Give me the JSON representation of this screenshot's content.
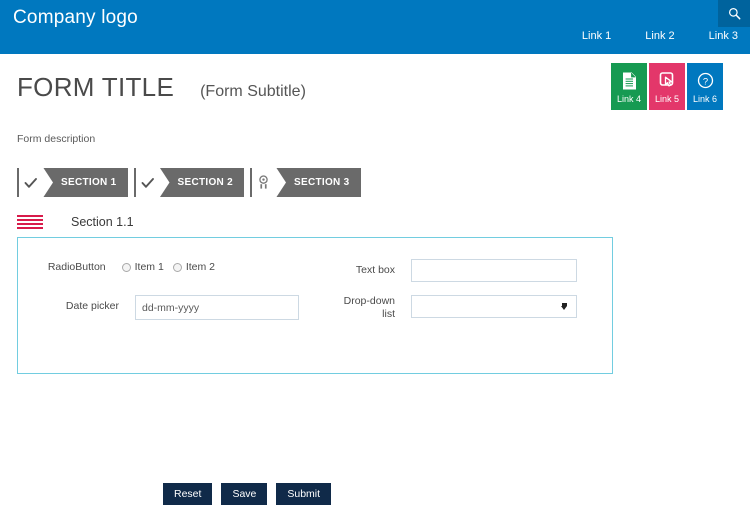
{
  "header": {
    "logo": "Company logo",
    "search_icon": "search-icon",
    "links": [
      {
        "label": "Link 1"
      },
      {
        "label": "Link 2"
      },
      {
        "label": "Link 3"
      }
    ],
    "bg_color": "#0078bf",
    "search_bg_color": "#00639d"
  },
  "title_block": {
    "title": "FORM TITLE",
    "subtitle": "(Form Subtitle)",
    "description": "Form description"
  },
  "tiles": [
    {
      "label": "Link 4",
      "icon": "document-icon",
      "color": "#169a52"
    },
    {
      "label": "Link 5",
      "icon": "click-cursor-icon",
      "color": "#e3376a"
    },
    {
      "label": "Link 6",
      "icon": "help-circle-icon",
      "color": "#0078bf"
    }
  ],
  "sections": [
    {
      "label": "SECTION 1",
      "icon": "check-icon",
      "bg_color": "#6a6a6a"
    },
    {
      "label": "SECTION 2",
      "icon": "check-icon",
      "bg_color": "#6a6a6a"
    },
    {
      "label": "SECTION 3",
      "icon": "award-icon",
      "bg_color": "#6a6a6a"
    }
  ],
  "subsection": {
    "menu_icon": "hamburger-icon",
    "menu_icon_color": "#d81b4a",
    "title": "Section 1.1",
    "panel_border_color": "#72cde0"
  },
  "form": {
    "radio": {
      "label": "RadioButton",
      "options": [
        {
          "label": "Item 1",
          "selected": false
        },
        {
          "label": "Item 2",
          "selected": false
        }
      ]
    },
    "date_picker": {
      "label": "Date picker",
      "value": "",
      "placeholder": "dd-mm-yyyy"
    },
    "text_box": {
      "label": "Text box",
      "value": "",
      "placeholder": ""
    },
    "dropdown": {
      "label_line1": "Drop-down",
      "label_line2": "list",
      "selected": "",
      "options": []
    }
  },
  "footer": {
    "buttons": [
      {
        "label": "Reset"
      },
      {
        "label": "Save"
      },
      {
        "label": "Submit"
      }
    ],
    "button_color": "#102a49"
  }
}
